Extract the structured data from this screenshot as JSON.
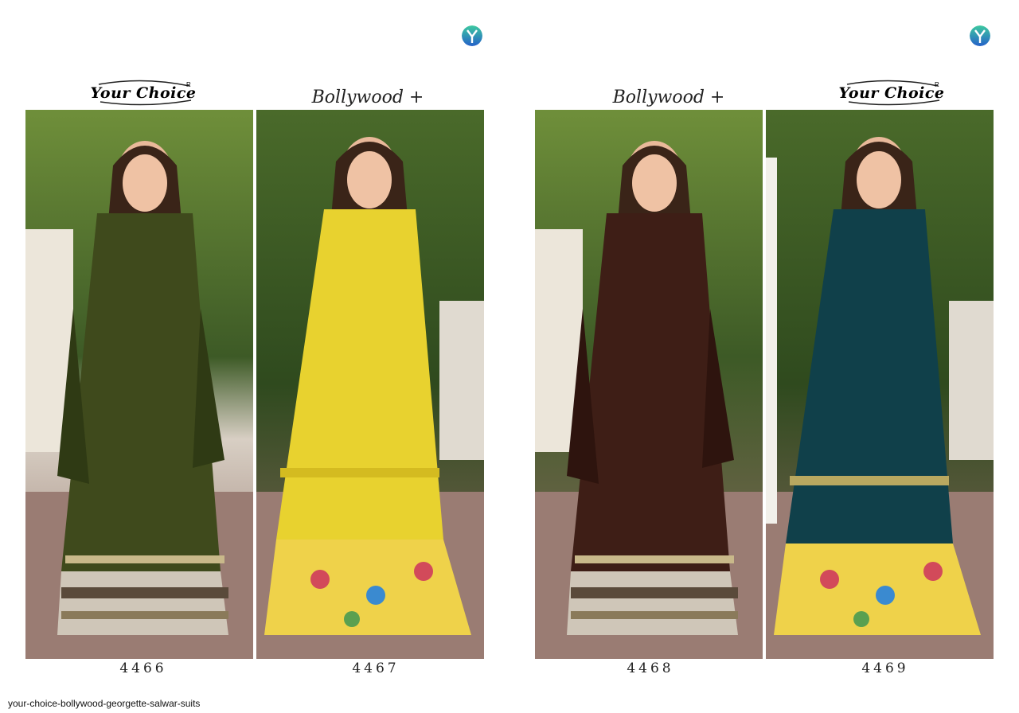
{
  "brand": {
    "name": "Your Choice",
    "mark": "R"
  },
  "sub_brand": "Bollywood +",
  "catalog": {
    "pages": [
      {
        "products": [
          {
            "code": "4466",
            "header": "brand",
            "kurta_color": "#3f4a1c",
            "bottom_color": "#cfc6b8"
          },
          {
            "code": "4467",
            "header": "sub_brand",
            "kurta_color": "#e8d22f",
            "bottom_color": "#efd24a"
          }
        ]
      },
      {
        "products": [
          {
            "code": "4468",
            "header": "sub_brand",
            "kurta_color": "#3e1e16",
            "bottom_color": "#cfc6b8"
          },
          {
            "code": "4469",
            "header": "brand",
            "kurta_color": "#10404a",
            "bottom_color": "#efd24a"
          }
        ]
      }
    ]
  },
  "caption": "your-choice-bollywood-georgette-salwar-suits",
  "colors": {
    "logo_top": "#22b3a8",
    "logo_bottom": "#2b6fd0"
  }
}
